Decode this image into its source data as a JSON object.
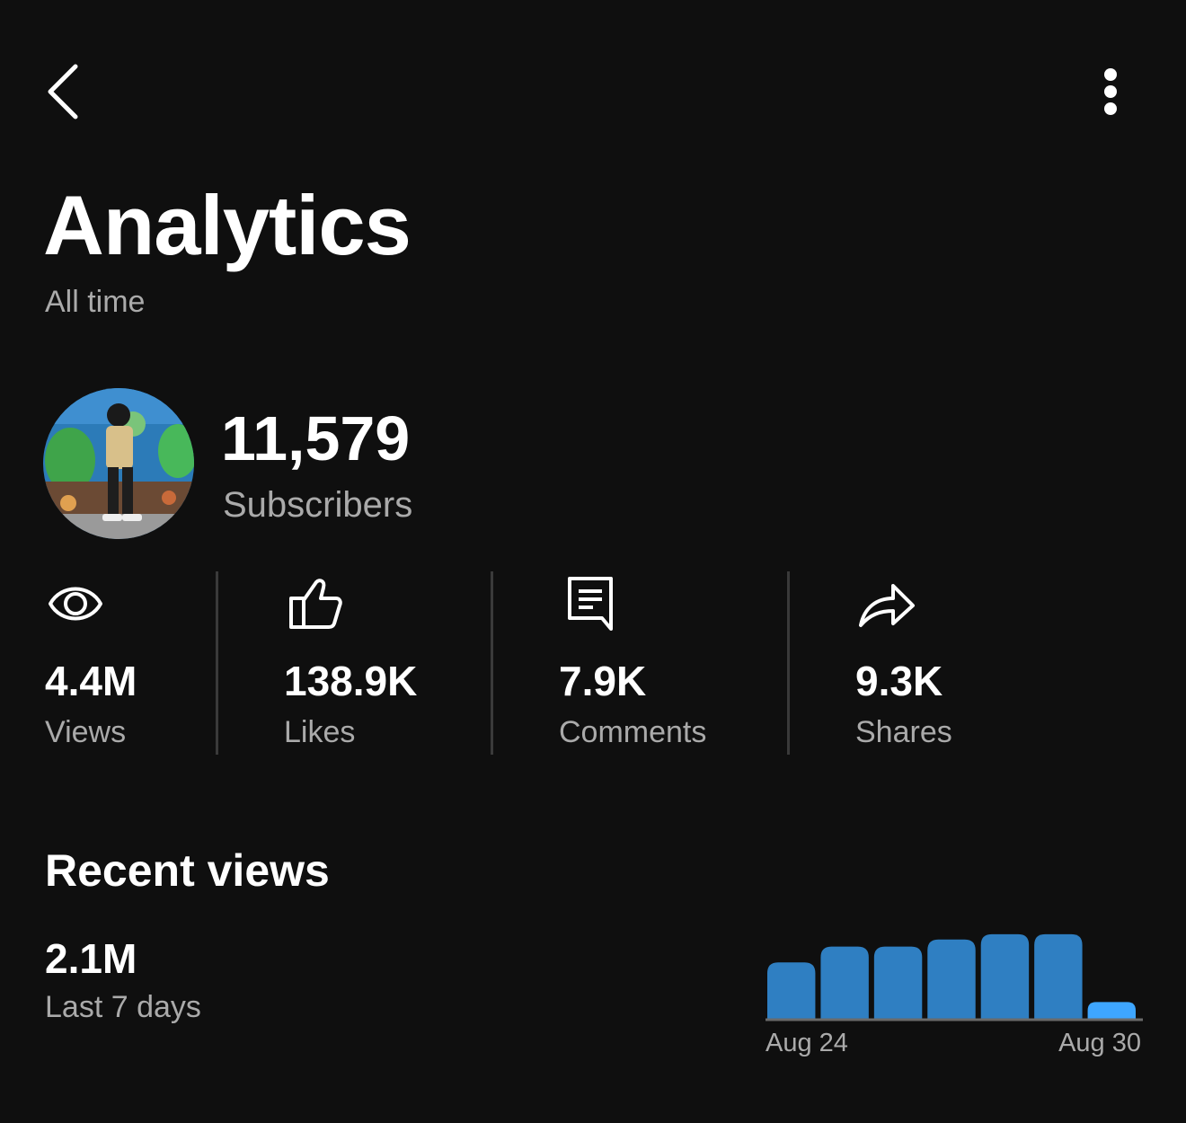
{
  "header": {
    "back_icon": "chevron-left-icon",
    "menu_icon": "more-vertical-icon",
    "title": "Analytics",
    "subtitle": "All time"
  },
  "channel": {
    "subscriber_count": "11,579",
    "subscriber_label": "Subscribers"
  },
  "stats": [
    {
      "icon": "eye-icon",
      "value": "4.4M",
      "label": "Views"
    },
    {
      "icon": "thumbs-up-icon",
      "value": "138.9K",
      "label": "Likes"
    },
    {
      "icon": "comment-icon",
      "value": "7.9K",
      "label": "Comments"
    },
    {
      "icon": "share-icon",
      "value": "9.3K",
      "label": "Shares"
    }
  ],
  "recent": {
    "title": "Recent views",
    "value": "2.1M",
    "period": "Last 7 days"
  },
  "colors": {
    "background": "#0f0f0f",
    "bar": "#2f7fc2",
    "bar_current": "#3ea6ff",
    "secondary_text": "#aaaaaa"
  },
  "chart_data": {
    "type": "bar",
    "categories": [
      "Aug 24",
      "Aug 25",
      "Aug 26",
      "Aug 27",
      "Aug 28",
      "Aug 29",
      "Aug 30"
    ],
    "tick_labels": [
      "Aug 24",
      "Aug 30"
    ],
    "values": [
      0.64,
      0.82,
      0.82,
      0.9,
      0.96,
      0.96,
      0.19
    ],
    "value_scale": "relative",
    "ylim": [
      0,
      1
    ],
    "grid": false,
    "legend": "none"
  }
}
